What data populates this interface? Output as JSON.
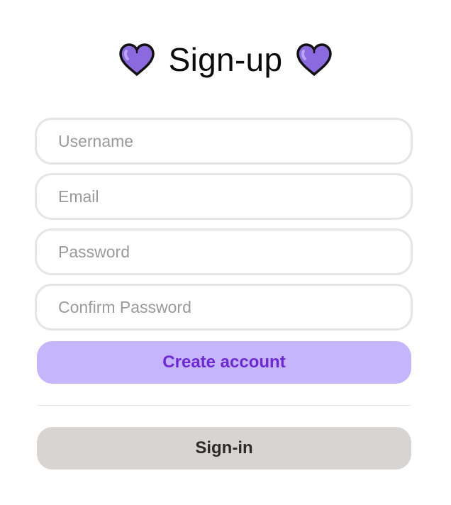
{
  "header": {
    "title": "Sign-up",
    "left_icon": "purple-heart-icon",
    "right_icon": "purple-heart-icon"
  },
  "form": {
    "username_placeholder": "Username",
    "username_value": "",
    "email_placeholder": "Email",
    "email_value": "",
    "password_placeholder": "Password",
    "password_value": "",
    "confirm_placeholder": "Confirm Password",
    "confirm_value": ""
  },
  "actions": {
    "create_label": "Create account",
    "signin_label": "Sign-in"
  },
  "colors": {
    "heart": "#8b6ae0",
    "primary_bg": "#c4b5fd",
    "primary_text": "#6d28d9",
    "secondary_bg": "#d8d4d1",
    "secondary_text": "#2d2a28",
    "field_border": "#e5e5e5"
  }
}
